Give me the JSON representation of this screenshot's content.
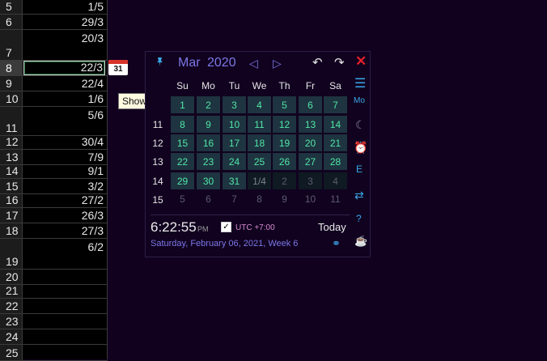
{
  "sheet": {
    "rows": [
      {
        "num": "5",
        "value": "1/5"
      },
      {
        "num": "6",
        "value": "29/3"
      },
      {
        "num": "7",
        "value": "20/3"
      },
      {
        "num": "8",
        "value": "22/3"
      },
      {
        "num": "9",
        "value": "22/4"
      },
      {
        "num": "10",
        "value": "1/6"
      },
      {
        "num": "11",
        "value": "5/6"
      },
      {
        "num": "12",
        "value": "30/4"
      },
      {
        "num": "13",
        "value": "7/9"
      },
      {
        "num": "14",
        "value": "9/1"
      },
      {
        "num": "15",
        "value": "3/2"
      },
      {
        "num": "16",
        "value": "27/2"
      },
      {
        "num": "17",
        "value": "26/3"
      },
      {
        "num": "18",
        "value": "27/3"
      },
      {
        "num": "19",
        "value": "6/2"
      },
      {
        "num": "20",
        "value": ""
      },
      {
        "num": "21",
        "value": ""
      },
      {
        "num": "22",
        "value": ""
      },
      {
        "num": "23",
        "value": ""
      },
      {
        "num": "24",
        "value": ""
      },
      {
        "num": "25",
        "value": ""
      }
    ]
  },
  "calendar_button": {
    "label": "31"
  },
  "tooltip": {
    "text": "Show Calendar"
  },
  "calendar": {
    "month": "Mar",
    "year": "2020",
    "weekdays": [
      "Su",
      "Mo",
      "Tu",
      "We",
      "Th",
      "Fr",
      "Sa"
    ],
    "weeks": [
      {
        "num": "",
        "days": [
          "1",
          "2",
          "3",
          "4",
          "5",
          "6",
          "7"
        ]
      },
      {
        "num": "11",
        "days": [
          "8",
          "9",
          "10",
          "11",
          "12",
          "13",
          "14"
        ]
      },
      {
        "num": "12",
        "days": [
          "15",
          "16",
          "17",
          "18",
          "19",
          "20",
          "21"
        ]
      },
      {
        "num": "13",
        "days": [
          "22",
          "23",
          "24",
          "25",
          "26",
          "27",
          "28"
        ]
      },
      {
        "num": "14",
        "days": [
          "29",
          "30",
          "31",
          "1/4",
          "2",
          "3",
          "4"
        ]
      },
      {
        "num": "15",
        "days": [
          "5",
          "6",
          "7",
          "8",
          "9",
          "10",
          "11"
        ]
      }
    ],
    "time": "6:22:55",
    "ampm": "PM",
    "utc_checked": "✓",
    "utc_label": "UTC +7:00",
    "today_label": "Today",
    "full_date": "Saturday, February 06, 2021, Week 6",
    "side_labels": {
      "mo": "Mo",
      "e": "E"
    },
    "icons": {
      "pin": "pin-icon",
      "prev": "prev-month-icon",
      "next": "next-month-icon",
      "undo": "undo-icon",
      "redo": "redo-icon",
      "close": "close-icon",
      "menu": "menu-icon",
      "moon": "moon-icon",
      "alarm": "alarm-icon",
      "swap": "swap-icon",
      "help": "help-icon",
      "link": "link-icon",
      "coffee": "coffee-icon"
    },
    "colors": {
      "accent": "#7b78e6",
      "current_day": "#50e6a6",
      "cell_bg": "#1e3440",
      "close": "#e0202a",
      "side_icons": "#3ba9ea"
    }
  }
}
